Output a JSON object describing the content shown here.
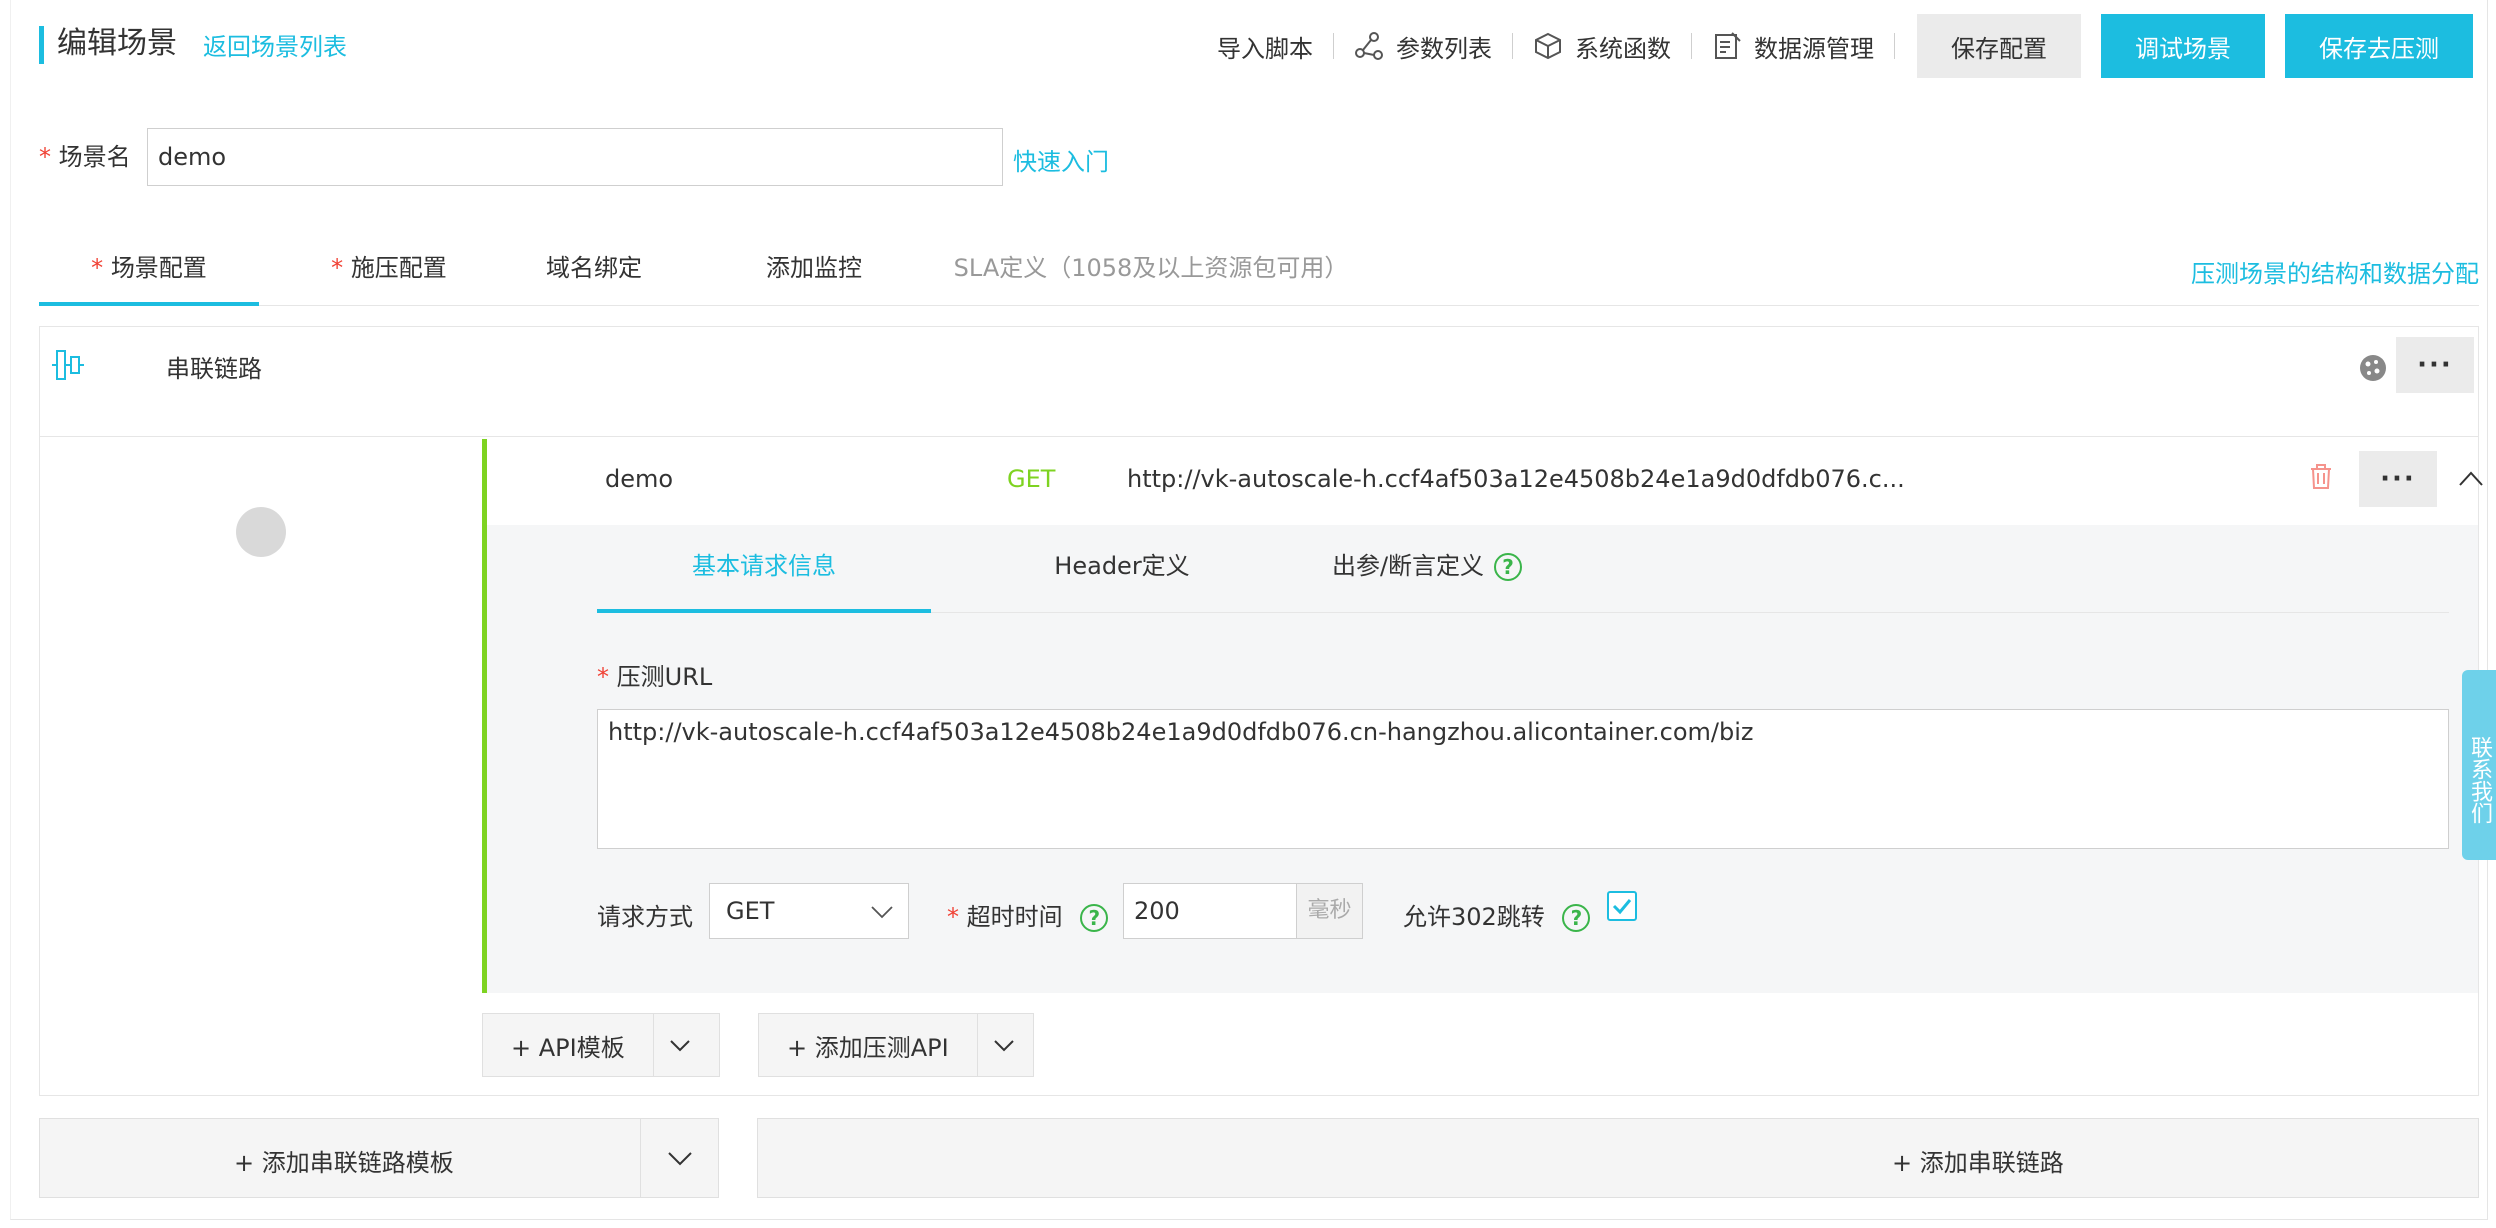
{
  "header": {
    "title": "编辑场景",
    "back_link": "返回场景列表",
    "tools": {
      "import_script": "导入脚本",
      "param_list": "参数列表",
      "system_functions": "系统函数",
      "datasource_mgmt": "数据源管理"
    },
    "buttons": {
      "save_config": "保存配置",
      "debug_scene": "调试场景",
      "save_and_test": "保存去压测"
    }
  },
  "scene": {
    "required_mark": "*",
    "label": "场景名",
    "value": "demo",
    "quick_start": "快速入门"
  },
  "tabs": {
    "scene_config": "场景配置",
    "load_config": "施压配置",
    "domain_binding": "域名绑定",
    "add_monitor": "添加监控",
    "sla": "SLA定义（1058及以上资源包可用）",
    "structure_link": "压测场景的结构和数据分配"
  },
  "chain": {
    "title": "串联链路",
    "more": "···"
  },
  "api": {
    "name": "demo",
    "method": "GET",
    "url_short": "http://vk-autoscale-h.ccf4af503a12e4508b24e1a9d0dfdb076.c...",
    "more": "···",
    "subtabs": {
      "basic": "基本请求信息",
      "header": "Header定义",
      "output": "出参/断言定义"
    },
    "url_label": "压测URL",
    "url_value": "http://vk-autoscale-h.ccf4af503a12e4508b24e1a9d0dfdb076.cn-hangzhou.alicontainer.com/biz",
    "method_label": "请求方式",
    "method_value": "GET",
    "timeout_label": "超时时间",
    "timeout_value": "200",
    "timeout_unit": "毫秒",
    "redirect_label": "允许302跳转",
    "redirect_checked": true,
    "help": "?"
  },
  "actions": {
    "api_template": "+   API模板",
    "add_api": "+   添加压测API",
    "add_chain_template": "+   添加串联链路模板",
    "add_chain": "+ 添加串联链路"
  },
  "contact": "联系我们",
  "colors": {
    "accent": "#1cbde0",
    "success": "#7ed321",
    "required": "#f04134",
    "help": "#3ab54a"
  }
}
